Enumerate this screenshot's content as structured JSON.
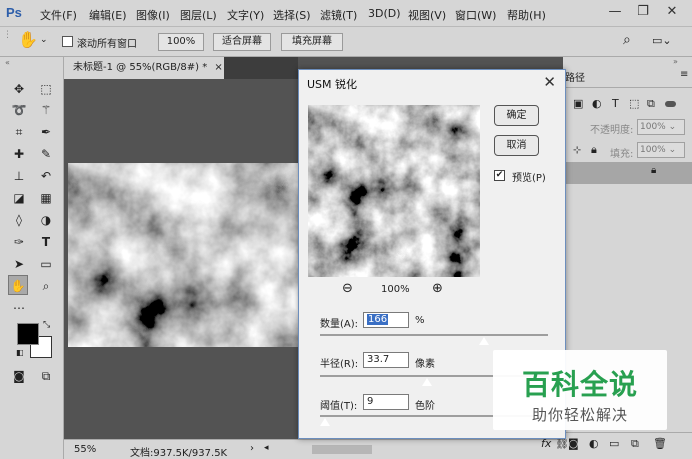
{
  "app": {
    "logo": "Ps"
  },
  "menubar": {
    "items": [
      "文件(F)",
      "编辑(E)",
      "图像(I)",
      "图层(L)",
      "文字(Y)",
      "选择(S)",
      "滤镜(T)",
      "3D(D)",
      "视图(V)",
      "窗口(W)",
      "帮助(H)"
    ],
    "window_controls": {
      "minimize": "—",
      "restore": "❐",
      "close": "✕"
    }
  },
  "options": {
    "scroll_all_windows": "滚动所有窗口",
    "scroll_all_checked": false,
    "zoom_100": "100%",
    "fit_screen": "适合屏幕",
    "fill_screen": "填充屏幕"
  },
  "document": {
    "tab_title": "未标题-1 @ 55%(RGB/8#) *",
    "tab_close": "×",
    "zoom": "55%",
    "doc_info": "文档:937.5K/937.5K"
  },
  "right_panel": {
    "paths_tab": "路径",
    "opacity_label": "不透明度:",
    "opacity_value": "100%",
    "fill_label": "填充:",
    "fill_value": "100%"
  },
  "dialog": {
    "title": "USM 锐化",
    "ok": "确定",
    "cancel": "取消",
    "preview_label": "预览(P)",
    "preview_checked": true,
    "zoom_level": "100%",
    "amount": {
      "label": "数量(A):",
      "value": "166",
      "unit": "%",
      "slider": 0.72
    },
    "radius": {
      "label": "半径(R):",
      "value": "33.7",
      "unit": "像素",
      "slider": 0.47
    },
    "threshold": {
      "label": "阈值(T):",
      "value": "9",
      "unit": "色阶",
      "slider": 0.02
    }
  },
  "watermark": {
    "line1": "百科全说",
    "line2": "助你轻松解决"
  },
  "colors": {
    "foreground": "#000000",
    "background": "#ffffff",
    "accent": "#2d5eaa",
    "watermark_green": "#28a050"
  }
}
